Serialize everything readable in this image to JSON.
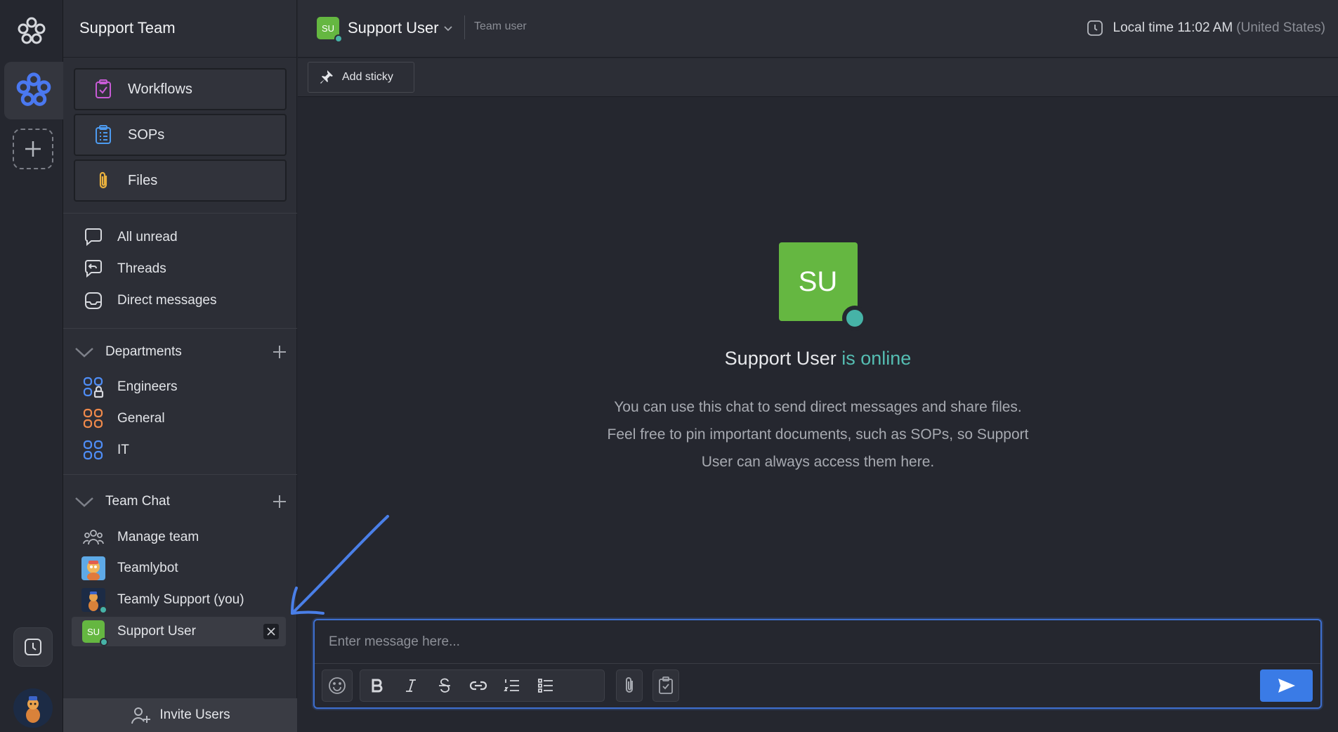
{
  "sidebar": {
    "team_name": "Support Team",
    "quick_buttons": [
      {
        "label": "Workflows",
        "icon": "workflows-icon"
      },
      {
        "label": "SOPs",
        "icon": "sops-icon"
      },
      {
        "label": "Files",
        "icon": "paperclip-icon"
      }
    ],
    "nav": [
      {
        "label": "All unread",
        "icon": "chat-bubble-icon"
      },
      {
        "label": "Threads",
        "icon": "threads-icon"
      },
      {
        "label": "Direct messages",
        "icon": "inbox-icon"
      }
    ],
    "departments": {
      "title": "Departments",
      "items": [
        {
          "label": "Engineers",
          "icon": "locked-channel-icon",
          "color": "#4f8ef7"
        },
        {
          "label": "General",
          "icon": "channel-icon",
          "color": "#f08a4b"
        },
        {
          "label": "IT",
          "icon": "channel-icon",
          "color": "#4f8ef7"
        }
      ]
    },
    "team_chat": {
      "title": "Team Chat",
      "items": [
        {
          "label": "Manage team",
          "icon": "team-icon"
        },
        {
          "label": "Teamlybot",
          "icon": "bot-avatar"
        },
        {
          "label": "Teamly Support (you)",
          "icon": "user-avatar"
        },
        {
          "label": "Support User",
          "initials": "SU"
        }
      ]
    },
    "invite_label": "Invite Users"
  },
  "header": {
    "user_initials": "SU",
    "user_name": "Support User",
    "role": "Team user",
    "time_label": "Local time 11:02 AM",
    "time_region": "(United States)"
  },
  "toolbar": {
    "add_sticky": "Add sticky"
  },
  "welcome": {
    "initials": "SU",
    "name": "Support User",
    "status": "is online",
    "description": "You can use this chat to send direct messages and share files. Feel free to pin important documents, such as SOPs, so Support User can always access them here."
  },
  "composer": {
    "placeholder": "Enter message here..."
  },
  "colors": {
    "accent": "#3a7be6",
    "online": "#46b3a7",
    "avatar_green": "#65b741"
  }
}
